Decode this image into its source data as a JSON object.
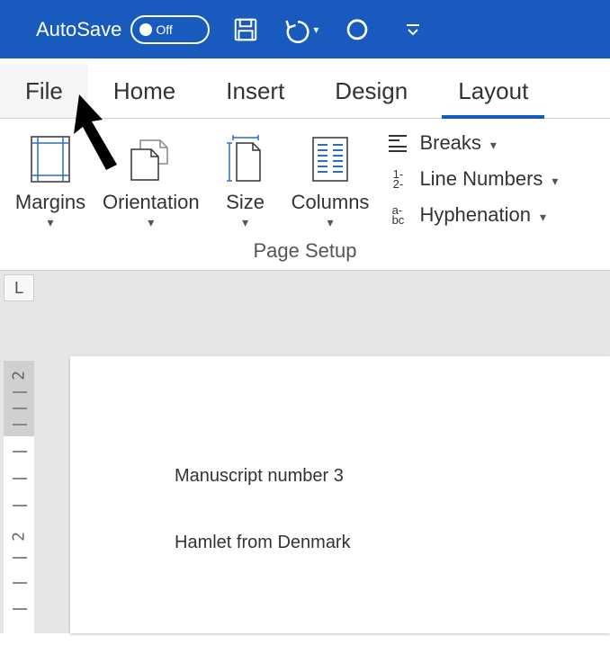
{
  "titlebar": {
    "autosave_label": "AutoSave",
    "autosave_toggle_text": "Off"
  },
  "tabs": {
    "file": "File",
    "home": "Home",
    "insert": "Insert",
    "design": "Design",
    "layout": "Layout"
  },
  "ribbon": {
    "margins": "Margins",
    "orientation": "Orientation",
    "size": "Size",
    "columns": "Columns",
    "breaks": "Breaks",
    "line_numbers": "Line Numbers",
    "hyphenation": "Hyphenation",
    "group_label": "Page Setup"
  },
  "ruler_corner": "L",
  "document": {
    "line1": "Manuscript number 3",
    "line2": "Hamlet from Denmark"
  }
}
